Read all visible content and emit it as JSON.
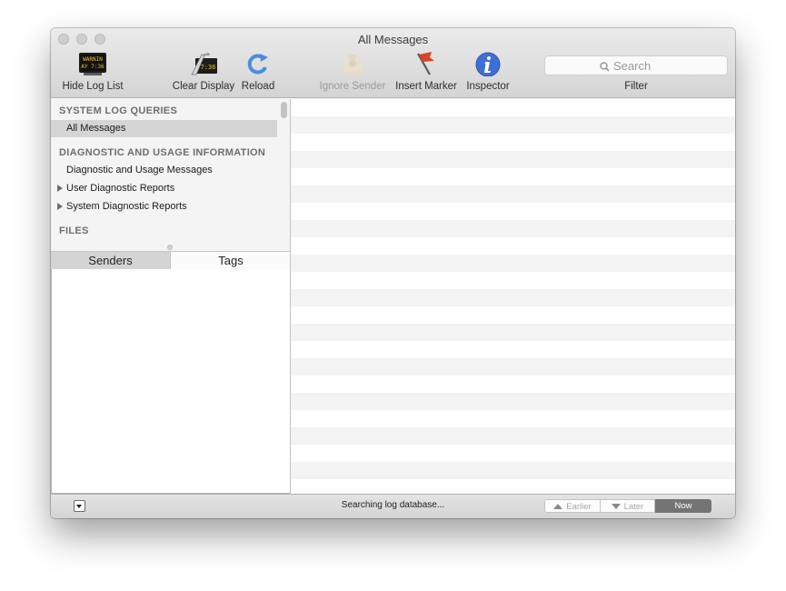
{
  "window": {
    "title": "All Messages"
  },
  "toolbar": {
    "hide_log_list": "Hide Log List",
    "clear_display": "Clear Display",
    "reload": "Reload",
    "ignore_sender": "Ignore Sender",
    "insert_marker": "Insert Marker",
    "inspector": "Inspector",
    "search_placeholder": "Search",
    "filter": "Filter",
    "log_icon_text_top": "WARNIN",
    "log_icon_text_bottom": "AY 7:36",
    "clear_icon_text": "7:36"
  },
  "sidebar": {
    "section_queries": "SYSTEM LOG QUERIES",
    "all_messages": "All Messages",
    "section_diagnostic": "DIAGNOSTIC AND USAGE INFORMATION",
    "diag_usage_messages": "Diagnostic and Usage Messages",
    "user_diag_reports": "User Diagnostic Reports",
    "system_diag_reports": "System Diagnostic Reports",
    "section_files": "FILES"
  },
  "tabs": {
    "senders": "Senders",
    "tags": "Tags"
  },
  "status": {
    "text": "Searching log database...",
    "earlier": "Earlier",
    "later": "Later",
    "now": "Now"
  },
  "colors": {
    "inspector_blue": "#3f6fd6",
    "selection_gray": "#d5d5d5",
    "now_button": "#747474"
  }
}
